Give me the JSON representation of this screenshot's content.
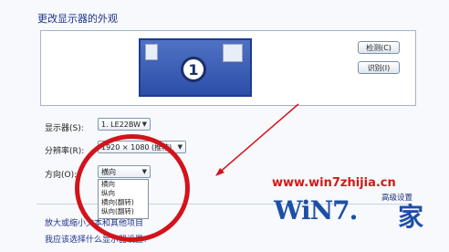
{
  "title": "更改显示器的外观",
  "preview": {
    "monitor_number": "1"
  },
  "buttons": {
    "detect": "检测(C)",
    "identify": "识别(I)"
  },
  "display": {
    "label": "显示器(S):",
    "value": "1. LE22BW"
  },
  "resolution": {
    "label": "分辨率(R):",
    "value": "1920 × 1080 (推荐)"
  },
  "orientation": {
    "label": "方向(O):",
    "value": "横向",
    "options": [
      "横向",
      "纵向",
      "横向(翻转)",
      "纵向(翻转)"
    ]
  },
  "advanced_link": "高级设置",
  "magnify_text": "放大或缩小文本和其他项目",
  "help_link": "我应该选择什么显示器设置?",
  "watermark": {
    "url": "www.win7zhijia.cn",
    "logo": "WiN7.",
    "logo_cn": "家"
  },
  "colors": {
    "annotation": "#d3131b",
    "accent": "#1e3287"
  }
}
